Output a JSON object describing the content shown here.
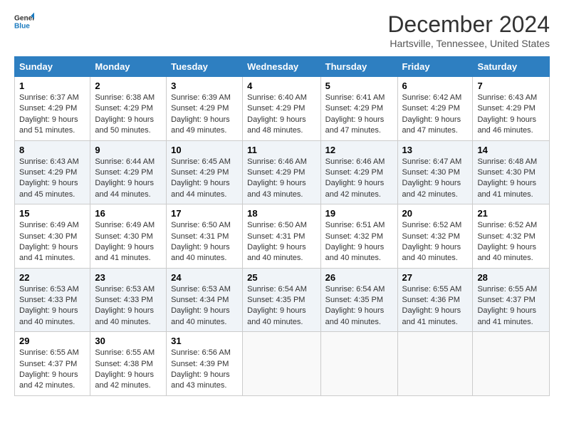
{
  "header": {
    "logo_line1": "General",
    "logo_line2": "Blue",
    "month_title": "December 2024",
    "location": "Hartsville, Tennessee, United States"
  },
  "days_of_week": [
    "Sunday",
    "Monday",
    "Tuesday",
    "Wednesday",
    "Thursday",
    "Friday",
    "Saturday"
  ],
  "weeks": [
    [
      {
        "day": 1,
        "sunrise": "6:37 AM",
        "sunset": "4:29 PM",
        "daylight": "9 hours and 51 minutes."
      },
      {
        "day": 2,
        "sunrise": "6:38 AM",
        "sunset": "4:29 PM",
        "daylight": "9 hours and 50 minutes."
      },
      {
        "day": 3,
        "sunrise": "6:39 AM",
        "sunset": "4:29 PM",
        "daylight": "9 hours and 49 minutes."
      },
      {
        "day": 4,
        "sunrise": "6:40 AM",
        "sunset": "4:29 PM",
        "daylight": "9 hours and 48 minutes."
      },
      {
        "day": 5,
        "sunrise": "6:41 AM",
        "sunset": "4:29 PM",
        "daylight": "9 hours and 47 minutes."
      },
      {
        "day": 6,
        "sunrise": "6:42 AM",
        "sunset": "4:29 PM",
        "daylight": "9 hours and 47 minutes."
      },
      {
        "day": 7,
        "sunrise": "6:43 AM",
        "sunset": "4:29 PM",
        "daylight": "9 hours and 46 minutes."
      }
    ],
    [
      {
        "day": 8,
        "sunrise": "6:43 AM",
        "sunset": "4:29 PM",
        "daylight": "9 hours and 45 minutes."
      },
      {
        "day": 9,
        "sunrise": "6:44 AM",
        "sunset": "4:29 PM",
        "daylight": "9 hours and 44 minutes."
      },
      {
        "day": 10,
        "sunrise": "6:45 AM",
        "sunset": "4:29 PM",
        "daylight": "9 hours and 44 minutes."
      },
      {
        "day": 11,
        "sunrise": "6:46 AM",
        "sunset": "4:29 PM",
        "daylight": "9 hours and 43 minutes."
      },
      {
        "day": 12,
        "sunrise": "6:46 AM",
        "sunset": "4:29 PM",
        "daylight": "9 hours and 42 minutes."
      },
      {
        "day": 13,
        "sunrise": "6:47 AM",
        "sunset": "4:30 PM",
        "daylight": "9 hours and 42 minutes."
      },
      {
        "day": 14,
        "sunrise": "6:48 AM",
        "sunset": "4:30 PM",
        "daylight": "9 hours and 41 minutes."
      }
    ],
    [
      {
        "day": 15,
        "sunrise": "6:49 AM",
        "sunset": "4:30 PM",
        "daylight": "9 hours and 41 minutes."
      },
      {
        "day": 16,
        "sunrise": "6:49 AM",
        "sunset": "4:30 PM",
        "daylight": "9 hours and 41 minutes."
      },
      {
        "day": 17,
        "sunrise": "6:50 AM",
        "sunset": "4:31 PM",
        "daylight": "9 hours and 40 minutes."
      },
      {
        "day": 18,
        "sunrise": "6:50 AM",
        "sunset": "4:31 PM",
        "daylight": "9 hours and 40 minutes."
      },
      {
        "day": 19,
        "sunrise": "6:51 AM",
        "sunset": "4:32 PM",
        "daylight": "9 hours and 40 minutes."
      },
      {
        "day": 20,
        "sunrise": "6:52 AM",
        "sunset": "4:32 PM",
        "daylight": "9 hours and 40 minutes."
      },
      {
        "day": 21,
        "sunrise": "6:52 AM",
        "sunset": "4:32 PM",
        "daylight": "9 hours and 40 minutes."
      }
    ],
    [
      {
        "day": 22,
        "sunrise": "6:53 AM",
        "sunset": "4:33 PM",
        "daylight": "9 hours and 40 minutes."
      },
      {
        "day": 23,
        "sunrise": "6:53 AM",
        "sunset": "4:33 PM",
        "daylight": "9 hours and 40 minutes."
      },
      {
        "day": 24,
        "sunrise": "6:53 AM",
        "sunset": "4:34 PM",
        "daylight": "9 hours and 40 minutes."
      },
      {
        "day": 25,
        "sunrise": "6:54 AM",
        "sunset": "4:35 PM",
        "daylight": "9 hours and 40 minutes."
      },
      {
        "day": 26,
        "sunrise": "6:54 AM",
        "sunset": "4:35 PM",
        "daylight": "9 hours and 40 minutes."
      },
      {
        "day": 27,
        "sunrise": "6:55 AM",
        "sunset": "4:36 PM",
        "daylight": "9 hours and 41 minutes."
      },
      {
        "day": 28,
        "sunrise": "6:55 AM",
        "sunset": "4:37 PM",
        "daylight": "9 hours and 41 minutes."
      }
    ],
    [
      {
        "day": 29,
        "sunrise": "6:55 AM",
        "sunset": "4:37 PM",
        "daylight": "9 hours and 42 minutes."
      },
      {
        "day": 30,
        "sunrise": "6:55 AM",
        "sunset": "4:38 PM",
        "daylight": "9 hours and 42 minutes."
      },
      {
        "day": 31,
        "sunrise": "6:56 AM",
        "sunset": "4:39 PM",
        "daylight": "9 hours and 43 minutes."
      },
      null,
      null,
      null,
      null
    ]
  ]
}
